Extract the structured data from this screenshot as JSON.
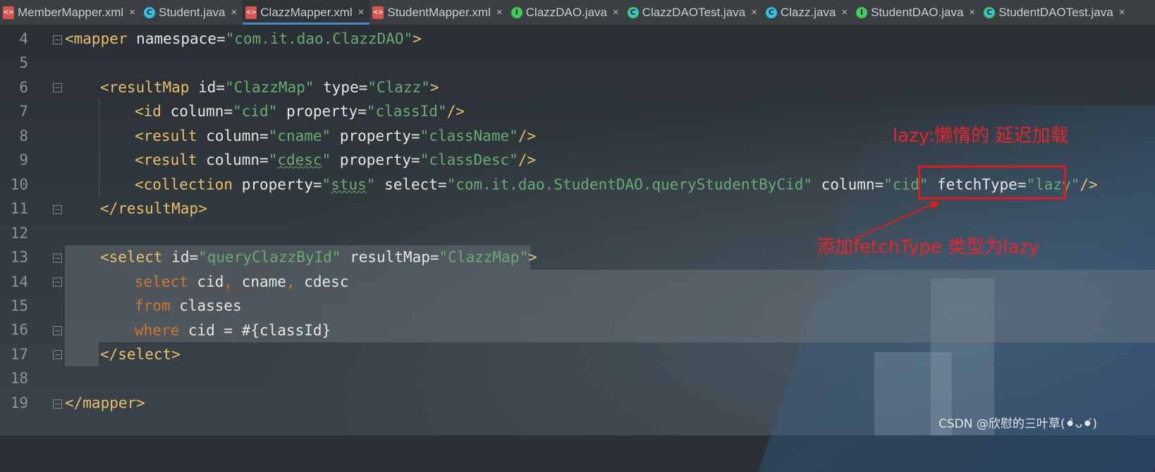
{
  "tabs": [
    {
      "label": "MemberMapper.xml",
      "kind": "xml",
      "active": false
    },
    {
      "label": "Student.java",
      "kind": "class",
      "active": false
    },
    {
      "label": "ClazzMapper.xml",
      "kind": "xml",
      "active": true
    },
    {
      "label": "StudentMapper.xml",
      "kind": "xml",
      "active": false
    },
    {
      "label": "ClazzDAO.java",
      "kind": "interface",
      "active": false
    },
    {
      "label": "ClazzDAOTest.java",
      "kind": "test",
      "active": false
    },
    {
      "label": "Clazz.java",
      "kind": "class",
      "active": false
    },
    {
      "label": "StudentDAO.java",
      "kind": "interface",
      "active": false
    },
    {
      "label": "StudentDAOTest.java",
      "kind": "test",
      "active": false
    }
  ],
  "close_glyph": "×",
  "line_numbers": [
    "4",
    "5",
    "6",
    "7",
    "8",
    "9",
    "10",
    "11",
    "12",
    "13",
    "14",
    "15",
    "16",
    "17",
    "18",
    "19"
  ],
  "code": {
    "l4": {
      "open": "<mapper",
      "a1": "namespace",
      "eq": "=",
      "v1": "\"com.it.dao.ClazzDAO\"",
      "close": ">"
    },
    "l6": {
      "open": "<resultMap",
      "a1": "id",
      "v1": "\"ClazzMap\"",
      "a2": "type",
      "v2": "\"Clazz\"",
      "close": ">"
    },
    "l7": {
      "open": "<id",
      "a1": "column",
      "v1": "\"cid\"",
      "a2": "property",
      "v2": "\"classId\"",
      "close": "/>"
    },
    "l8": {
      "open": "<result",
      "a1": "column",
      "v1": "\"cname\"",
      "a2": "property",
      "v2": "\"className\"",
      "close": "/>"
    },
    "l9": {
      "open": "<result",
      "a1": "column",
      "v1q": "\"",
      "v1w": "cdesc",
      "a2": "property",
      "v2": "\"classDesc\"",
      "close": "/>"
    },
    "l10": {
      "open": "<collection",
      "a1": "property",
      "v1w": "stus",
      "a2": "select",
      "v2": "\"com.it.dao.StudentDAO.queryStudentByCid\"",
      "a3": "column",
      "v3": "\"cid\"",
      "a4": "fetchType",
      "v4": "\"lazy\"",
      "close": "/>"
    },
    "l11": {
      "close_tag": "</resultMap>"
    },
    "l13": {
      "open": "<select",
      "a1": "id",
      "v1": "\"queryClazzById\"",
      "a2": "resultMap",
      "v2": "\"ClazzMap\"",
      "close": ">"
    },
    "l14": {
      "kw": "select",
      "rest1": " cid",
      "c1": ",",
      "rest2": " cname",
      "c2": ",",
      "rest3": " cdesc"
    },
    "l15": {
      "kw": "from",
      "rest": " classes"
    },
    "l16": {
      "kw": "where",
      "rest": " cid = #{classId}"
    },
    "l17": {
      "close_tag": "</select>"
    },
    "l19": {
      "close_tag": "</mapper>"
    }
  },
  "annotations": {
    "lazy_note": "lazy:懒惰的     延迟加载",
    "fetch_note": "添加fetchType 类型为lazy"
  },
  "watermark": "CSDN @欣慰的三叶草(⚫︎̀ᴗ⚫︎́)",
  "colors": {
    "tag": "#e8bf6a",
    "value": "#6aab73",
    "keyword": "#cc7832",
    "annotation": "#e8262a"
  }
}
